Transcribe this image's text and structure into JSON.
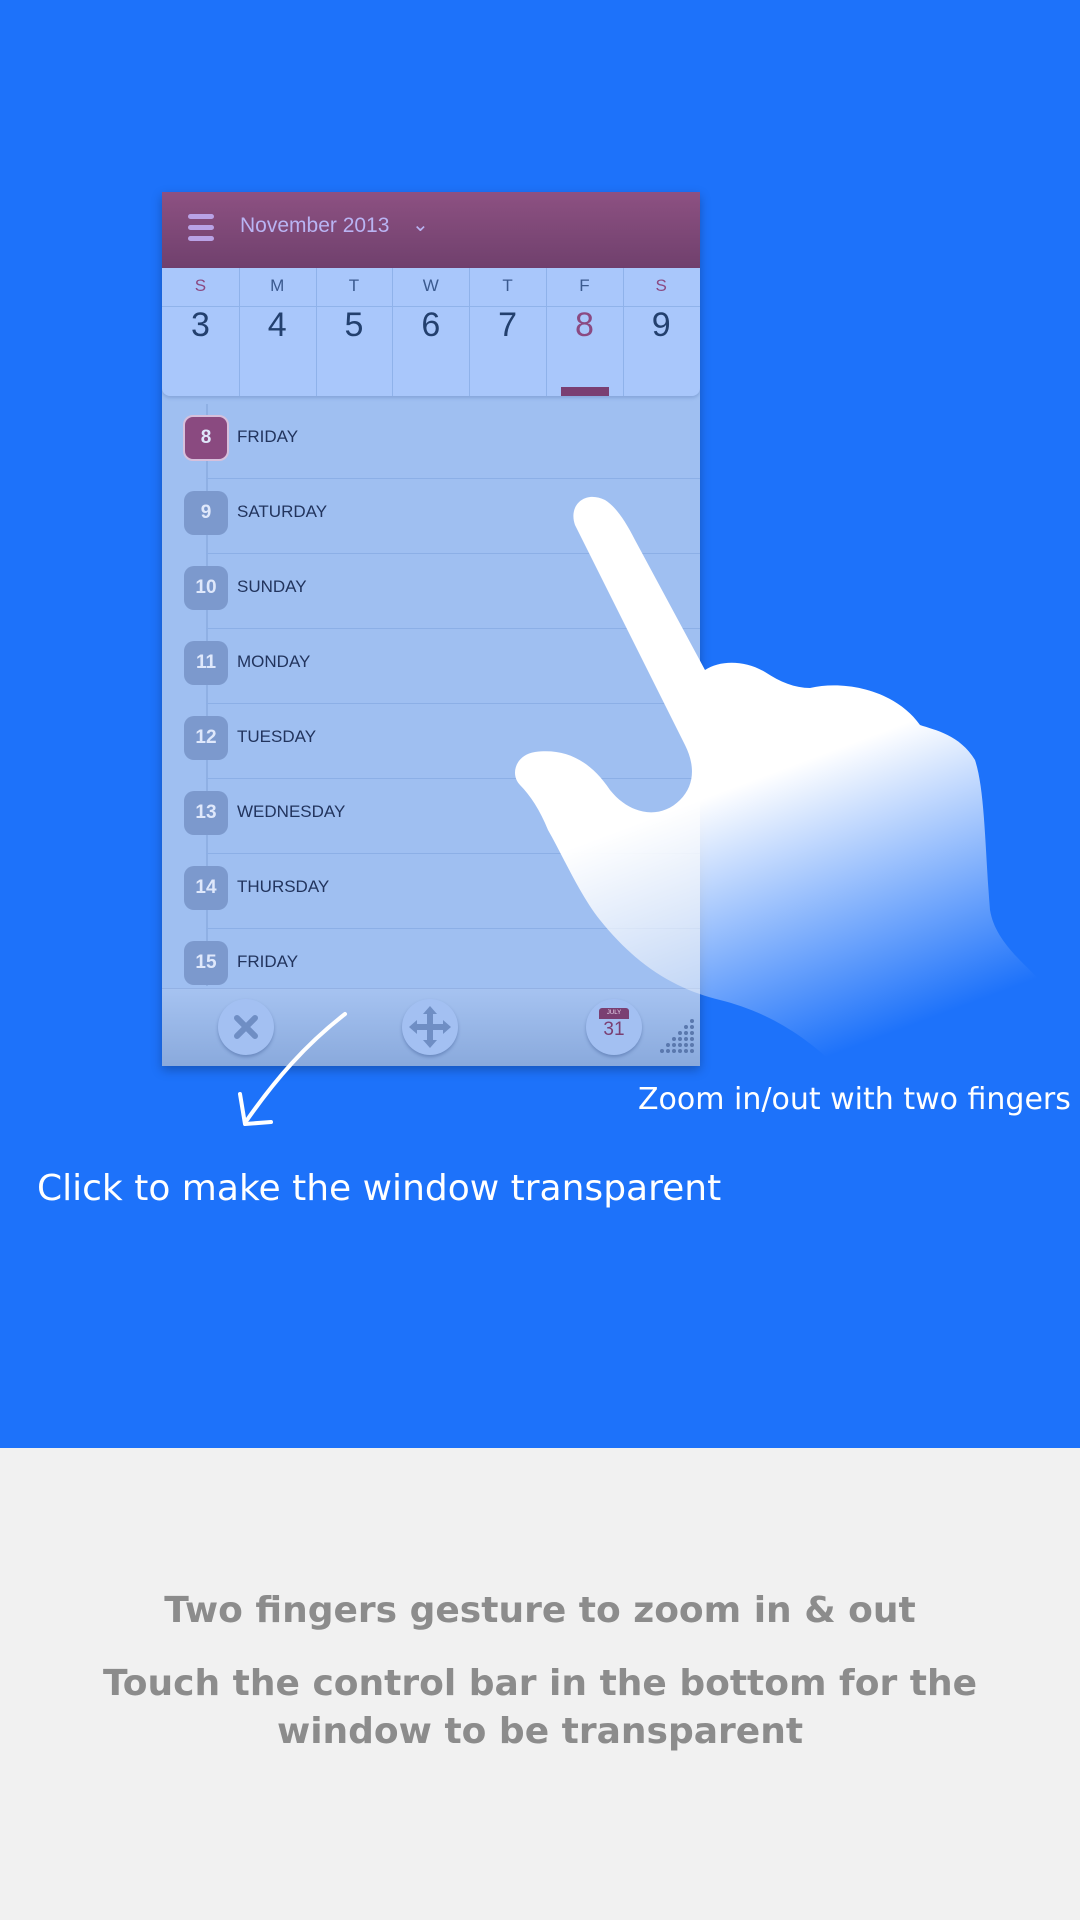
{
  "colors": {
    "hero_bg": "#1d72fa",
    "page_bg": "#f1f1f1",
    "header_bg": "#7a446f",
    "accent": "#8b4a82",
    "widget_bg": "#9fbff1"
  },
  "widget": {
    "month_title": "November 2013",
    "week": [
      {
        "dow": "S",
        "num": "3"
      },
      {
        "dow": "M",
        "num": "4"
      },
      {
        "dow": "T",
        "num": "5"
      },
      {
        "dow": "W",
        "num": "6"
      },
      {
        "dow": "T",
        "num": "7"
      },
      {
        "dow": "F",
        "num": "8"
      },
      {
        "dow": "S",
        "num": "9"
      }
    ],
    "agenda": [
      {
        "num": "8",
        "label": "FRIDAY"
      },
      {
        "num": "9",
        "label": "SATURDAY"
      },
      {
        "num": "10",
        "label": "SUNDAY"
      },
      {
        "num": "11",
        "label": "MONDAY"
      },
      {
        "num": "12",
        "label": "TUESDAY"
      },
      {
        "num": "13",
        "label": "WEDNESDAY"
      },
      {
        "num": "14",
        "label": "THURSDAY"
      },
      {
        "num": "15",
        "label": "FRIDAY"
      }
    ],
    "today_calendar": {
      "month": "JULY",
      "day": "31"
    }
  },
  "hints": {
    "zoom": "Zoom in/out with two fingers",
    "click": "Click to make the window transparent"
  },
  "footer": {
    "line1": "Two fingers gesture to zoom in & out",
    "line2": "Touch the control bar in the bottom for the window to be transparent"
  }
}
